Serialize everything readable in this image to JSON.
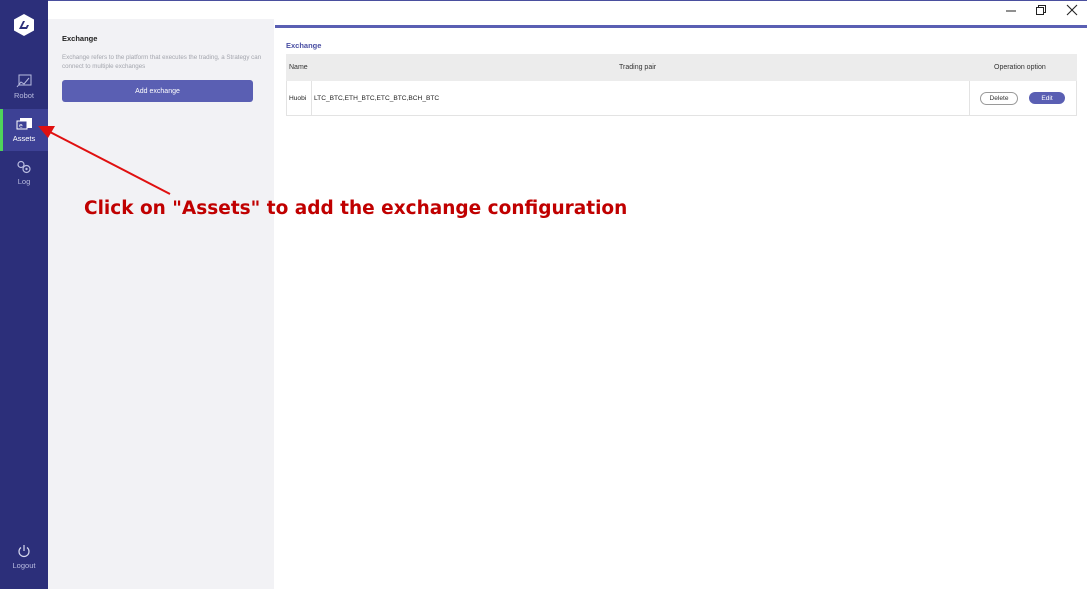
{
  "nav": {
    "items": [
      {
        "label": "Robot",
        "icon": "robot-chart-icon"
      },
      {
        "label": "Assets",
        "icon": "wallet-icon",
        "active": true
      },
      {
        "label": "Log",
        "icon": "gears-icon"
      }
    ],
    "logout_label": "Logout",
    "active_indicator_color": "#4fd35b",
    "bg_color": "#2c2f7a"
  },
  "panel": {
    "title": "Exchange",
    "description": "Exchange refers to the platform that executes the trading, a Strategy can connect to multiple exchanges",
    "add_button_label": "Add exchange"
  },
  "main": {
    "title": "Exchange",
    "table": {
      "headers": {
        "name": "Name",
        "pair": "Trading pair",
        "ops": "Operation option"
      },
      "rows": [
        {
          "name": "Huobi",
          "pair": "LTC_BTC,ETH_BTC,ETC_BTC,BCH_BTC",
          "delete_label": "Delete",
          "edit_label": "Edit"
        }
      ]
    }
  },
  "annotation": {
    "text": "Click on \"Assets\" to add the exchange configuration",
    "color": "#c00000"
  },
  "accent_color": "#5a5fb3"
}
